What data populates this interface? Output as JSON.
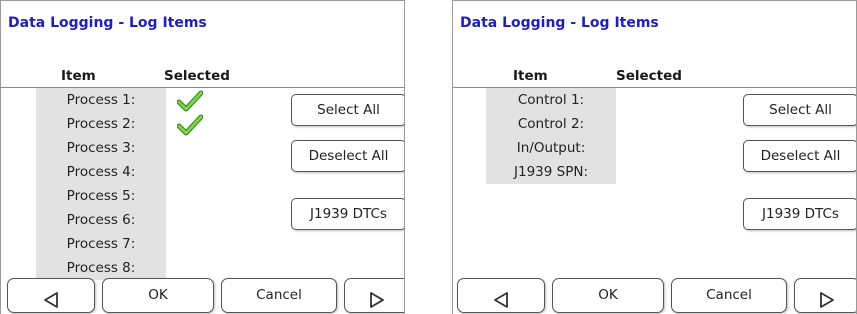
{
  "screens": [
    {
      "title": "Data Logging - Log Items",
      "header_item": "Item",
      "header_selected": "Selected",
      "items": [
        {
          "label": "Process 1:",
          "selected": true
        },
        {
          "label": "Process 2:",
          "selected": true
        },
        {
          "label": "Process 3:",
          "selected": false
        },
        {
          "label": "Process 4:",
          "selected": false
        },
        {
          "label": "Process 5:",
          "selected": false
        },
        {
          "label": "Process 6:",
          "selected": false
        },
        {
          "label": "Process 7:",
          "selected": false
        },
        {
          "label": "Process 8:",
          "selected": false
        }
      ],
      "select_all_label": "Select All",
      "deselect_all_label": "Deselect All",
      "dtc_label": "J1939 DTCs",
      "ok_label": "OK",
      "cancel_label": "Cancel",
      "prev_icon": "left-triangle-icon",
      "next_icon": "right-triangle-icon"
    },
    {
      "title": "Data Logging - Log Items",
      "header_item": "Item",
      "header_selected": "Selected",
      "items": [
        {
          "label": "Control 1:",
          "selected": false
        },
        {
          "label": "Control 2:",
          "selected": false
        },
        {
          "label": "In/Output:",
          "selected": false
        },
        {
          "label": "J1939 SPN:",
          "selected": false
        }
      ],
      "select_all_label": "Select All",
      "deselect_all_label": "Deselect All",
      "dtc_label": "J1939 DTCs",
      "ok_label": "OK",
      "cancel_label": "Cancel",
      "prev_icon": "left-triangle-icon",
      "next_icon": "right-triangle-icon"
    }
  ],
  "colors": {
    "title": "#1e1ec8",
    "panel_bg": "#e2e2e2",
    "check_green": "#5cb82a"
  }
}
